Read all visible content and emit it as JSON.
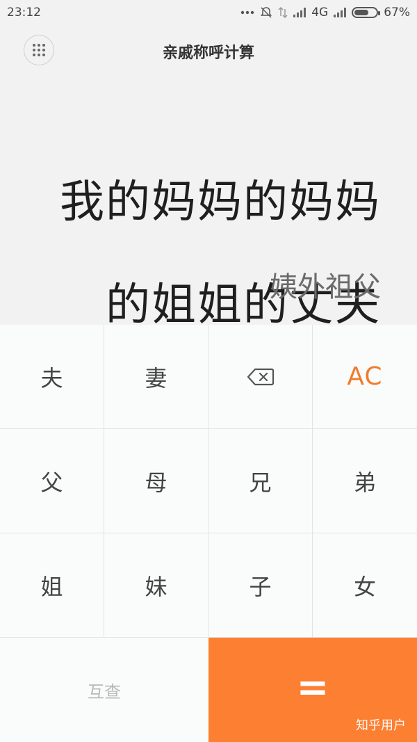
{
  "status_bar": {
    "time": "23:12",
    "network": "4G",
    "battery": "67%",
    "battery_level": 0.67
  },
  "header": {
    "title": "亲戚称呼计算",
    "menu_icon": "grid-dots-icon"
  },
  "display": {
    "expression_line1": "我的妈妈的妈妈",
    "expression_line2": "的姐姐的丈夫",
    "result": "姨外祖父"
  },
  "keypad": {
    "row1": [
      "夫",
      "妻",
      "",
      "AC"
    ],
    "row2": [
      "父",
      "母",
      "兄",
      "弟"
    ],
    "row3": [
      "姐",
      "妹",
      "子",
      "女"
    ],
    "backspace_icon": "backspace-icon",
    "compare_label": "互查",
    "equals_label": "=",
    "watermark": "知乎用户"
  },
  "colors": {
    "accent": "#fc7f32",
    "ac_text": "#f07b2b"
  }
}
